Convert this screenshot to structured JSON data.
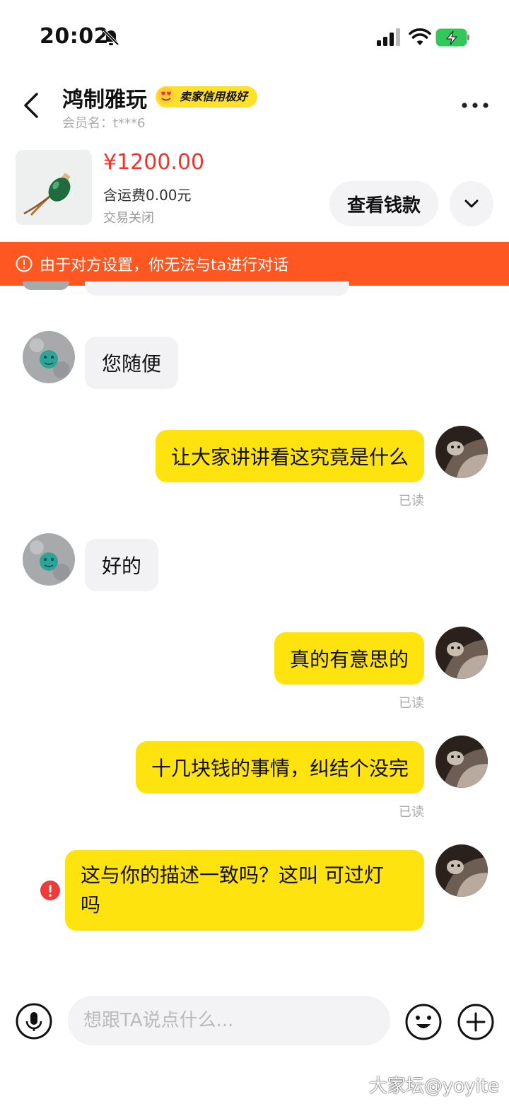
{
  "status_bar": {
    "time": "20:02"
  },
  "header": {
    "seller_name": "鸿制雅玩",
    "credit_badge": "卖家信用极好",
    "member_name": "会员名：t***6"
  },
  "product": {
    "price": "¥1200.00",
    "shipping": "含运费0.00元",
    "status": "交易关闭",
    "view_payment_label": "查看钱款"
  },
  "warning": {
    "text": "由于对方设置，你无法与ta进行对话"
  },
  "messages": [
    {
      "side": "left",
      "text": "您随便"
    },
    {
      "side": "right",
      "text": "让大家讲讲看这究竟是什么",
      "status": "已读"
    },
    {
      "side": "left",
      "text": "好的"
    },
    {
      "side": "right",
      "text": "真的有意思的",
      "status": "已读"
    },
    {
      "side": "right",
      "text": "十几块钱的事情，纠结个没完",
      "status": "已读"
    },
    {
      "side": "right",
      "text_line1": "这与你的描述一致吗？这叫 可过灯",
      "text_line2": "吗",
      "failed": true
    }
  ],
  "input": {
    "placeholder": "想跟TA说点什么..."
  },
  "watermark": "大家坛@yoyite",
  "colors": {
    "accent_yellow": "#ffe30f",
    "price_red": "#f0342d",
    "warning_orange": "#ff5722",
    "error_red": "#f03a3a"
  },
  "icons": [
    "back-icon",
    "more-icon",
    "bell-off-icon",
    "signal-icon",
    "wifi-icon",
    "battery-charging-icon",
    "chevron-down-icon",
    "warning-icon",
    "error-icon",
    "mic-icon",
    "emoji-icon",
    "plus-icon"
  ]
}
